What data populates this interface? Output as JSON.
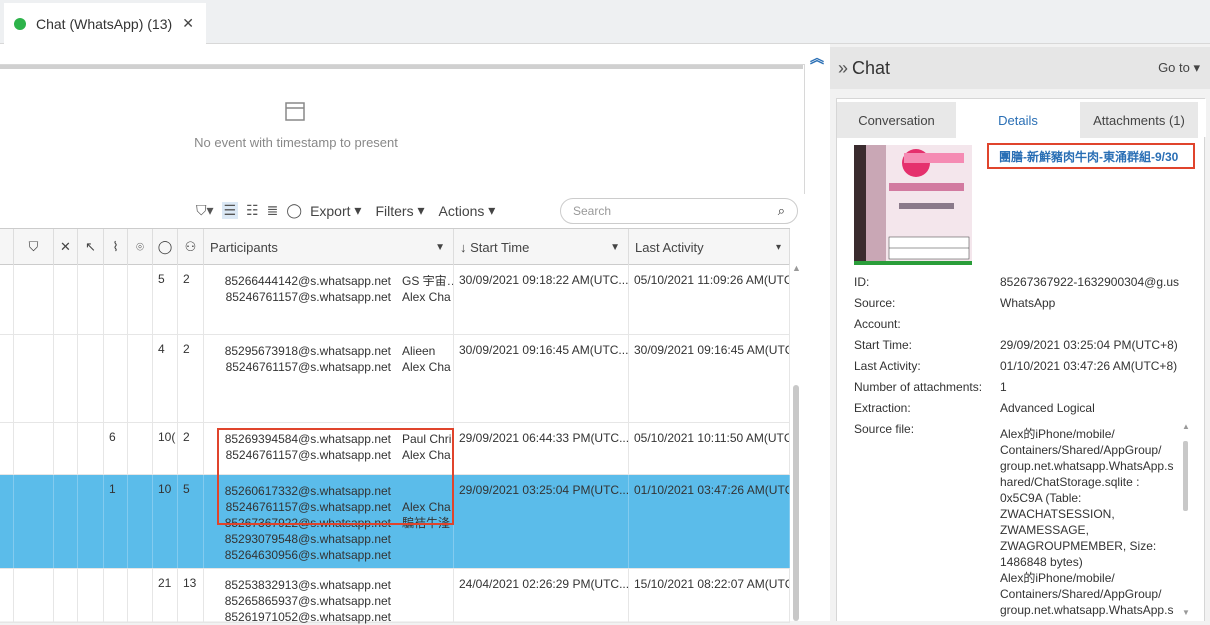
{
  "tab": {
    "title": "Chat (WhatsApp) (13)",
    "close": "✕",
    "status_color": "#2db34a"
  },
  "timeline": {
    "empty_message": "No event with timestamp to present"
  },
  "toolbar": {
    "export": "Export",
    "filters": "Filters",
    "actions": "Actions",
    "search_placeholder": "Search"
  },
  "grid": {
    "columns": [
      "Participants",
      "Start Time",
      "Last Activity"
    ],
    "rows": [
      {
        "attachments": "",
        "messages": "5",
        "participants_count": "2",
        "participants": [
          [
            "85266444142@s.whatsapp.net",
            "GS 宇宙…"
          ],
          [
            "85246761157@s.whatsapp.net",
            "Alex Cha"
          ]
        ],
        "start": "30/09/2021 09:18:22 AM(UTC...",
        "last": "05/10/2021 11:09:26 AM(UTC",
        "selected": false
      },
      {
        "attachments": "",
        "messages": "4",
        "participants_count": "2",
        "participants": [
          [
            "85295673918@s.whatsapp.net",
            "Alieen"
          ],
          [
            "85246761157@s.whatsapp.net",
            "Alex Cha"
          ]
        ],
        "start": "30/09/2021 09:16:45 AM(UTC...",
        "last": "30/09/2021 09:16:45 AM(UTC",
        "selected": false
      },
      {
        "attachments": "6",
        "messages": "10(",
        "participants_count": "2",
        "participants": [
          [
            "85269394584@s.whatsapp.net",
            "Paul Chri"
          ],
          [
            "85246761157@s.whatsapp.net",
            "Alex Cha"
          ]
        ],
        "start": "29/09/2021 06:44:33 PM(UTC...",
        "last": "05/10/2021 10:11:50 AM(UTC",
        "selected": false
      },
      {
        "attachments": "1",
        "messages": "10",
        "participants_count": "5",
        "participants": [
          [
            "85260617332@s.whatsapp.net",
            ""
          ],
          [
            "85246761157@s.whatsapp.net",
            "Alex Cha"
          ],
          [
            "85267367922@s.whatsapp.net",
            "騙袺牛湰"
          ],
          [
            "85293079548@s.whatsapp.net",
            ""
          ],
          [
            "85264630956@s.whatsapp.net",
            ""
          ]
        ],
        "start": "29/09/2021 03:25:04 PM(UTC...",
        "last": "01/10/2021 03:47:26 AM(UTC",
        "selected": true
      },
      {
        "attachments": "",
        "messages": "21",
        "participants_count": "13",
        "participants": [
          [
            "85253832913@s.whatsapp.net",
            ""
          ],
          [
            "85265865937@s.whatsapp.net",
            ""
          ],
          [
            "85261971052@s.whatsapp.net",
            ""
          ]
        ],
        "start": "24/04/2021 02:26:29 PM(UTC...",
        "last": "15/10/2021 08:22:07 AM(UTC",
        "selected": false
      }
    ]
  },
  "chat_panel": {
    "title": "Chat",
    "goto": "Go to",
    "tabs": [
      "Conversation",
      "Details",
      "Attachments (1)"
    ],
    "chat_name": "團膳-新鮮豬肉牛肉-東涌群組-9/30",
    "details": [
      {
        "label": "ID:",
        "value": "85267367922-1632900304@g.us"
      },
      {
        "label": "Source:",
        "value": "WhatsApp"
      },
      {
        "label": "Account:",
        "value": ""
      },
      {
        "label": "Start Time:",
        "value": "29/09/2021 03:25:04 PM(UTC+8)"
      },
      {
        "label": "Last Activity:",
        "value": "01/10/2021 03:47:26 AM(UTC+8)"
      },
      {
        "label": "Number of attachments:",
        "value": "1"
      },
      {
        "label": "Extraction:",
        "value": "Advanced Logical"
      },
      {
        "label": "Source file:",
        "value": ""
      }
    ],
    "source_file_lines": [
      "Alex的iPhone/mobile/",
      "Containers/Shared/AppGroup/",
      "group.net.whatsapp.WhatsApp.s",
      "hared/ChatStorage.sqlite :",
      "0x5C9A (Table:",
      "ZWACHATSESSION,",
      "ZWAMESSAGE,",
      "ZWAGROUPMEMBER, Size:",
      "1486848 bytes)",
      "Alex的iPhone/mobile/",
      "Containers/Shared/AppGroup/",
      "group.net.whatsapp.WhatsApp.s"
    ]
  },
  "colors": {
    "selected_row": "#5bbcea",
    "highlight": "#e0442c",
    "link": "#2a6fb5"
  }
}
